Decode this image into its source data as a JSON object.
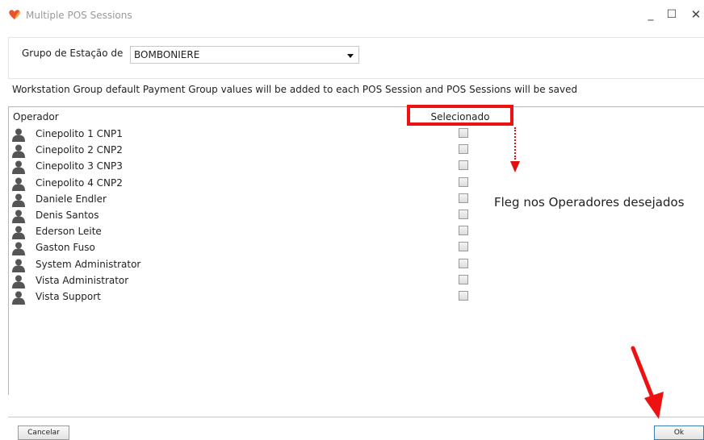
{
  "window": {
    "title": "Multiple POS Sessions",
    "minimize_glyph": "_",
    "maximize_glyph": "☐",
    "close_glyph": "✕"
  },
  "group": {
    "label": "Grupo de Estação de",
    "selected": "BOMBONIERE"
  },
  "info_text": "Workstation Group default Payment Group values will be added to each POS Session and POS Sessions will be saved",
  "table": {
    "columns": {
      "operador": "Operador",
      "selecionado": "Selecionado"
    },
    "rows": [
      {
        "name": "Cinepolito 1 CNP1",
        "checked": false
      },
      {
        "name": "Cinepolito 2 CNP2",
        "checked": false
      },
      {
        "name": "Cinepolito 3 CNP3",
        "checked": false
      },
      {
        "name": "Cinepolito 4 CNP2",
        "checked": false
      },
      {
        "name": "Daniele Endler",
        "checked": false
      },
      {
        "name": "Denis Santos",
        "checked": false
      },
      {
        "name": "Ederson Leite",
        "checked": false
      },
      {
        "name": "Gaston Fuso",
        "checked": false
      },
      {
        "name": "System Administrator",
        "checked": false
      },
      {
        "name": "Vista Administrator",
        "checked": false
      },
      {
        "name": "Vista Support",
        "checked": false
      }
    ]
  },
  "annotation": "Fleg nos Operadores desejados",
  "buttons": {
    "cancel": "Cancelar",
    "ok": "Ok"
  },
  "colors": {
    "highlight": "#ee1111",
    "logo": "#e8532c"
  },
  "icons": {
    "row_icon": "user-icon",
    "logo": "vista-logo-icon"
  }
}
